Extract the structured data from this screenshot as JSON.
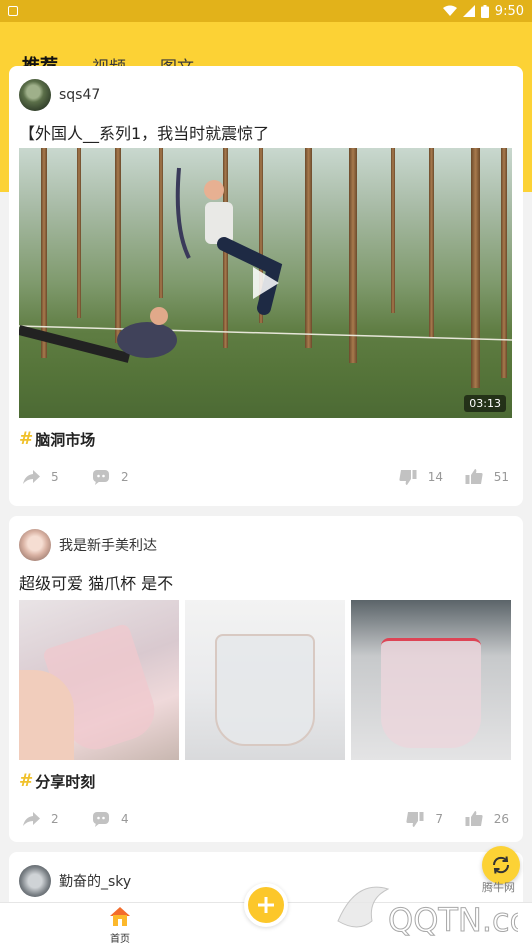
{
  "statusbar": {
    "time": "9:50"
  },
  "tabs": [
    {
      "label": "推荐",
      "active": true
    },
    {
      "label": "视频",
      "active": false
    },
    {
      "label": "图文",
      "active": false
    }
  ],
  "posts": [
    {
      "author": "sqs47",
      "title": "【外国人__系列1，我当时就震惊了",
      "video_duration": "03:13",
      "topic": "脑洞市场",
      "shares": "5",
      "comments": "2",
      "dislikes": "14",
      "likes": "51"
    },
    {
      "author": "我是新手美利达",
      "title": "超级可爱 猫爪杯  是不",
      "topic": "分享时刻",
      "shares": "2",
      "comments": "4",
      "dislikes": "7",
      "likes": "26"
    },
    {
      "author": "勤奋的_sky"
    }
  ],
  "bottom_nav": {
    "home_label": "首页"
  },
  "watermark": {
    "brand": "腾牛网",
    "site": "QQTN.com"
  },
  "colors": {
    "accent": "#fcd235",
    "statusbar": "#e2b21a"
  }
}
